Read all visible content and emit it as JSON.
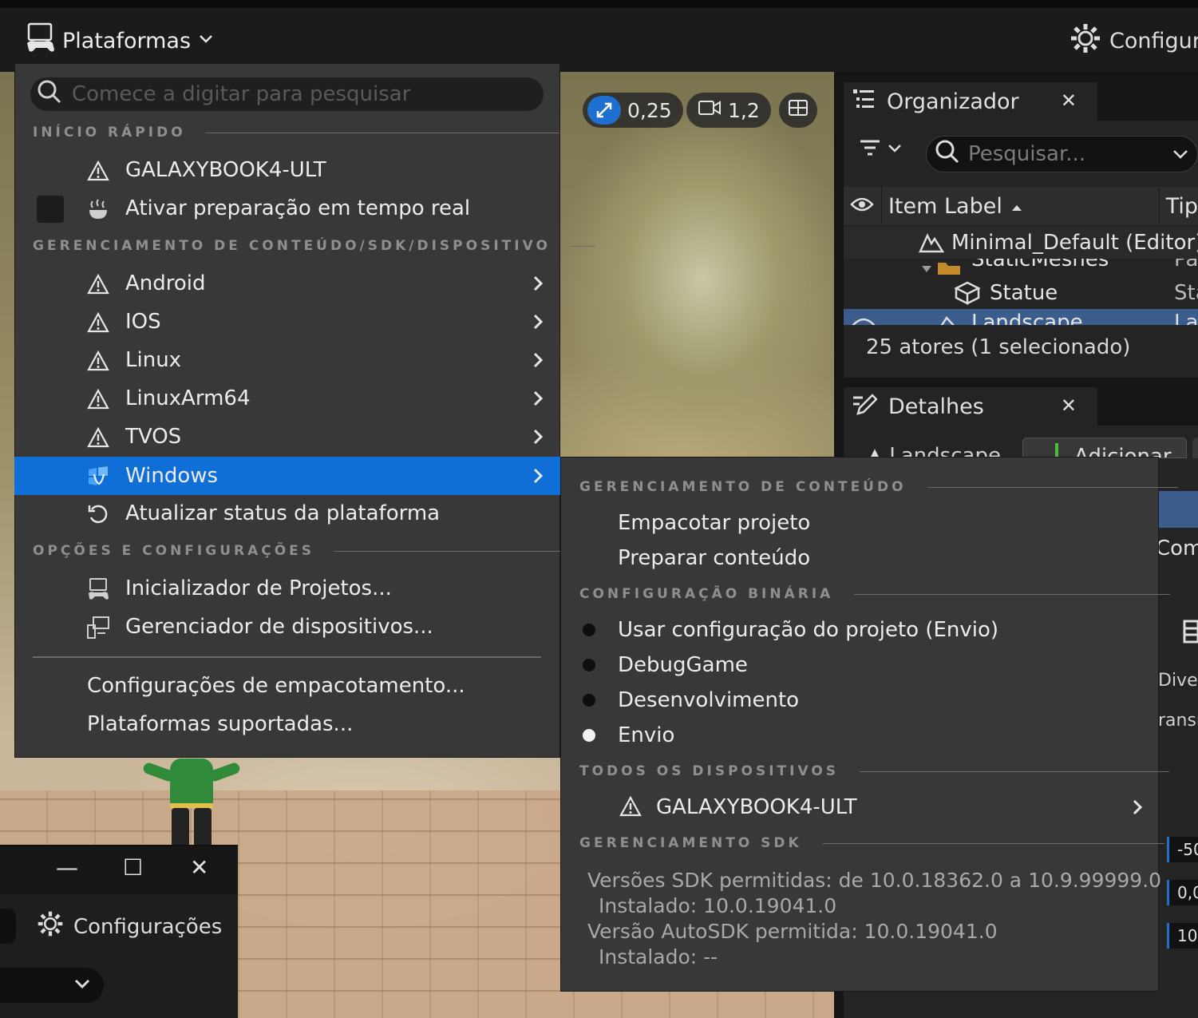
{
  "toolbar": {
    "platforms_label": "Plataformas",
    "settings_label": "Configura"
  },
  "viewport": {
    "scale_value": "0,25",
    "camera_speed": "1,2"
  },
  "outliner": {
    "tab_title": "Organizador",
    "search_placeholder": "Pesquisar...",
    "col_label": "Item Label",
    "col_type": "Tip",
    "rows": [
      {
        "label": "Minimal_Default (Editor)",
        "type": ""
      },
      {
        "label": "StaticMeshes",
        "type": "Pa"
      },
      {
        "label": "Statue",
        "type": "Sta"
      },
      {
        "label": "Landscape",
        "type": "La"
      }
    ],
    "count_text": "25 atores (1 selecionado)"
  },
  "details": {
    "tab_title": "Detalhes",
    "actor_name": "Landscape",
    "add_button": "Adicionar",
    "frag_com": "Com",
    "frag_diver": "Diver",
    "frag_transm": "ransm",
    "num1": "-50",
    "num2": "0,0",
    "num3": "10"
  },
  "mini_window": {
    "settings_label": "Configurações",
    "minimize": "—",
    "maximize": "☐",
    "close": "✕"
  },
  "platforms_menu": {
    "search_placeholder": "Comece a digitar para pesquisar",
    "section_quick": "INÍCIO RÁPIDO",
    "quick_device": "GALAXYBOOK4-ULT",
    "live_cook": "Ativar preparação em tempo real",
    "section_content": "GERENCIAMENTO DE CONTEÚDO/SDK/DISPOSITIVO",
    "platforms": [
      "Android",
      "IOS",
      "Linux",
      "LinuxArm64",
      "TVOS",
      "Windows"
    ],
    "refresh": "Atualizar status da plataforma",
    "section_options": "OPÇÕES E CONFIGURAÇÕES",
    "project_launcher": "Inicializador de Projetos...",
    "device_manager": "Gerenciador de dispositivos...",
    "packaging_settings": "Configurações de empacotamento...",
    "supported_platforms": "Plataformas suportadas..."
  },
  "windows_submenu": {
    "section_content": "GERENCIAMENTO DE CONTEÚDO",
    "package_project": "Empacotar projeto",
    "cook_content": "Preparar conteúdo",
    "section_binary": "CONFIGURAÇÃO BINÁRIA",
    "binary_options": [
      {
        "label": "Usar configuração do projeto (Envio)",
        "selected": false
      },
      {
        "label": "DebugGame",
        "selected": false
      },
      {
        "label": "Desenvolvimento",
        "selected": false
      },
      {
        "label": "Envio",
        "selected": true
      }
    ],
    "section_devices": "TODOS OS DISPOSITIVOS",
    "device": "GALAXYBOOK4-ULT",
    "section_sdk": "GERENCIAMENTO SDK",
    "sdk_lines": [
      "Versões SDK permitidas: de 10.0.18362.0 a 10.9.99999.0",
      "Instalado: 10.0.19041.0",
      "Versão AutoSDK permitida: 10.0.19041.0",
      "Instalado: --"
    ]
  },
  "colors": {
    "highlight": "#0f6fd6",
    "menu_bg": "#383838",
    "panel_bg": "#242424",
    "selection": "#3b5d8e"
  }
}
